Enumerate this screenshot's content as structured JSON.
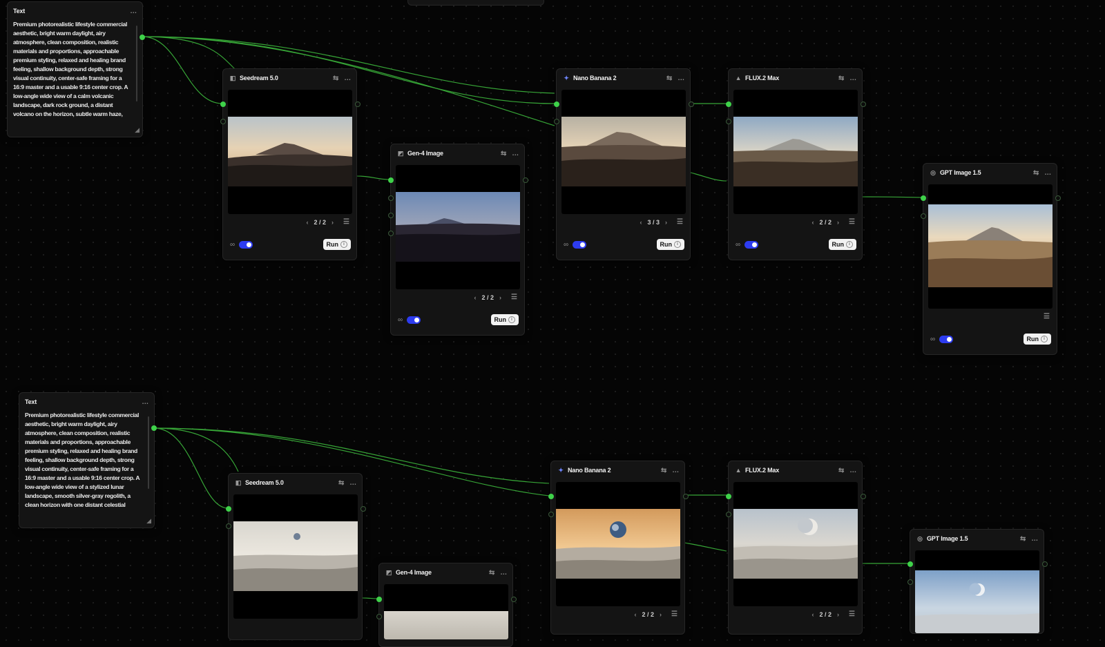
{
  "nodes": {
    "text_top": {
      "title": "Text",
      "body": "Premium photorealistic lifestyle commercial aesthetic, bright warm daylight, airy atmosphere, clean composition, realistic materials and proportions, approachable premium styling, relaxed and healing brand feeling, shallow background depth, strong visual continuity, center-safe framing for a 16:9 master and a usable 9:16 center crop. A low-angle wide view of a calm volcanic landscape, dark rock ground, a distant volcano on the horizon, subtle warm haze,"
    },
    "text_bottom": {
      "title": "Text",
      "body": "Premium photorealistic lifestyle commercial aesthetic, bright warm daylight, airy atmosphere, clean composition, realistic materials and proportions, approachable premium styling, relaxed and healing brand feeling, shallow background depth, strong visual continuity, center-safe framing for a 16:9 master and a usable 9:16 center crop. A low-angle wide view of a stylized lunar landscape, smooth silver-gray regolith, a clean horizon with one distant celestial"
    },
    "seedream_top": {
      "title": "Seedream 5.0",
      "page": "2 / 2",
      "run": "Run"
    },
    "gen4_top": {
      "title": "Gen-4 Image",
      "page": "2 / 2",
      "run": "Run"
    },
    "nano_top": {
      "title": "Nano Banana 2",
      "page": "3 / 3",
      "run": "Run"
    },
    "flux_top": {
      "title": "FLUX.2 Max",
      "page": "2 / 2",
      "run": "Run"
    },
    "gpt_top": {
      "title": "GPT Image 1.5",
      "run": "Run"
    },
    "seedream_bottom": {
      "title": "Seedream 5.0"
    },
    "gen4_bottom": {
      "title": "Gen-4 Image"
    },
    "nano_bottom": {
      "title": "Nano Banana 2",
      "page": "2 / 2"
    },
    "flux_bottom": {
      "title": "FLUX.2 Max",
      "page": "2 / 2"
    },
    "gpt_bottom": {
      "title": "GPT Image 1.5"
    }
  },
  "icons": {
    "more": "…",
    "settings": "⇆",
    "prev": "‹",
    "next": "›",
    "list": "☰",
    "link": "∞",
    "info": "i",
    "resize": "◢"
  },
  "colors": {
    "wire": "#3db83d",
    "toggle": "#2d3cf0",
    "canvas": "#050505"
  }
}
